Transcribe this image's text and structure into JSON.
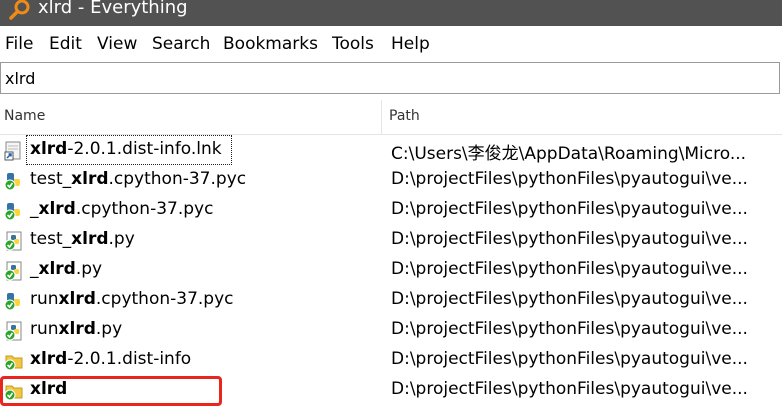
{
  "window": {
    "title": "xlrd - Everything"
  },
  "menu": [
    "File",
    "Edit",
    "View",
    "Search",
    "Bookmarks",
    "Tools",
    "Help"
  ],
  "search": {
    "value": "xlrd"
  },
  "columns": {
    "name": "Name",
    "path": "Path"
  },
  "rows": [
    {
      "pre": "",
      "bold": "xlrd",
      "post": "-2.0.1.dist-info.lnk",
      "path": "C:\\Users\\李俊龙\\AppData\\Roaming\\Micro...",
      "icon": "shortcut-icon"
    },
    {
      "pre": "test_",
      "bold": "xlrd",
      "post": ".cpython-37.pyc",
      "path": "D:\\projectFiles\\pythonFiles\\pyautogui\\ve...",
      "icon": "python-compiled-icon"
    },
    {
      "pre": "_",
      "bold": "xlrd",
      "post": ".cpython-37.pyc",
      "path": "D:\\projectFiles\\pythonFiles\\pyautogui\\ve...",
      "icon": "python-compiled-icon"
    },
    {
      "pre": "test_",
      "bold": "xlrd",
      "post": ".py",
      "path": "D:\\projectFiles\\pythonFiles\\pyautogui\\ve...",
      "icon": "python-file-icon"
    },
    {
      "pre": "_",
      "bold": "xlrd",
      "post": ".py",
      "path": "D:\\projectFiles\\pythonFiles\\pyautogui\\ve...",
      "icon": "python-file-icon"
    },
    {
      "pre": "run",
      "bold": "xlrd",
      "post": ".cpython-37.pyc",
      "path": "D:\\projectFiles\\pythonFiles\\pyautogui\\ve...",
      "icon": "python-compiled-icon"
    },
    {
      "pre": "run",
      "bold": "xlrd",
      "post": ".py",
      "path": "D:\\projectFiles\\pythonFiles\\pyautogui\\ve...",
      "icon": "python-file-icon"
    },
    {
      "pre": "",
      "bold": "xlrd",
      "post": "-2.0.1.dist-info",
      "path": "D:\\projectFiles\\pythonFiles\\pyautogui\\ve...",
      "icon": "folder-synced-icon"
    },
    {
      "pre": "",
      "bold": "xlrd",
      "post": "",
      "path": "D:\\projectFiles\\pythonFiles\\pyautogui\\ve...",
      "icon": "folder-synced-icon"
    }
  ],
  "colors": {
    "titlebar": "#525252",
    "highlight": "#e8261e",
    "sync_green": "#2aa52a"
  }
}
